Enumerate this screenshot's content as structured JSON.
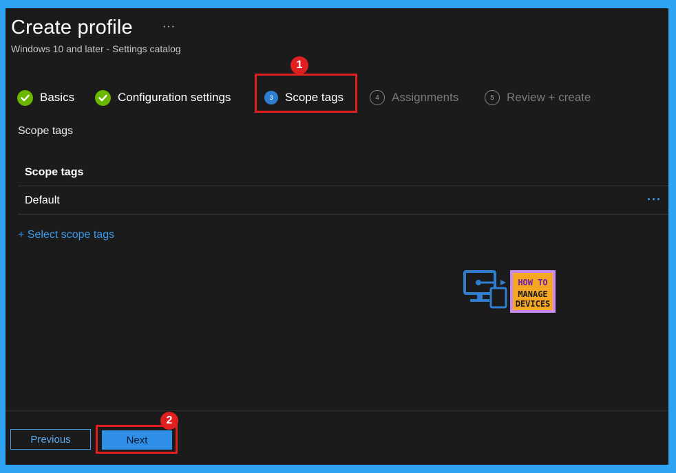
{
  "header": {
    "title": "Create profile",
    "more": "···",
    "subtitle": "Windows 10 and later - Settings catalog"
  },
  "steps": [
    {
      "label": "Basics",
      "state": "complete"
    },
    {
      "label": "Configuration settings",
      "state": "complete"
    },
    {
      "number": "3",
      "label": "Scope tags",
      "state": "active"
    },
    {
      "number": "4",
      "label": "Assignments",
      "state": "inactive"
    },
    {
      "number": "5",
      "label": "Review + create",
      "state": "inactive"
    }
  ],
  "annotations": {
    "badge_1": "1",
    "badge_2": "2"
  },
  "main": {
    "section_label": "Scope tags",
    "table": {
      "header": "Scope tags",
      "rows": [
        {
          "name": "Default",
          "more": "···"
        }
      ]
    },
    "select_link": "+ Select scope tags"
  },
  "logo": {
    "line1": "HOW TO",
    "line2": "MANAGE",
    "line3": "DEVICES"
  },
  "footer": {
    "previous_label": "Previous",
    "next_label": "Next"
  },
  "colors": {
    "accent": "#2f8fe6",
    "check_green": "#6bb700",
    "highlight_red": "#e02020",
    "background": "#1b1b1b"
  }
}
